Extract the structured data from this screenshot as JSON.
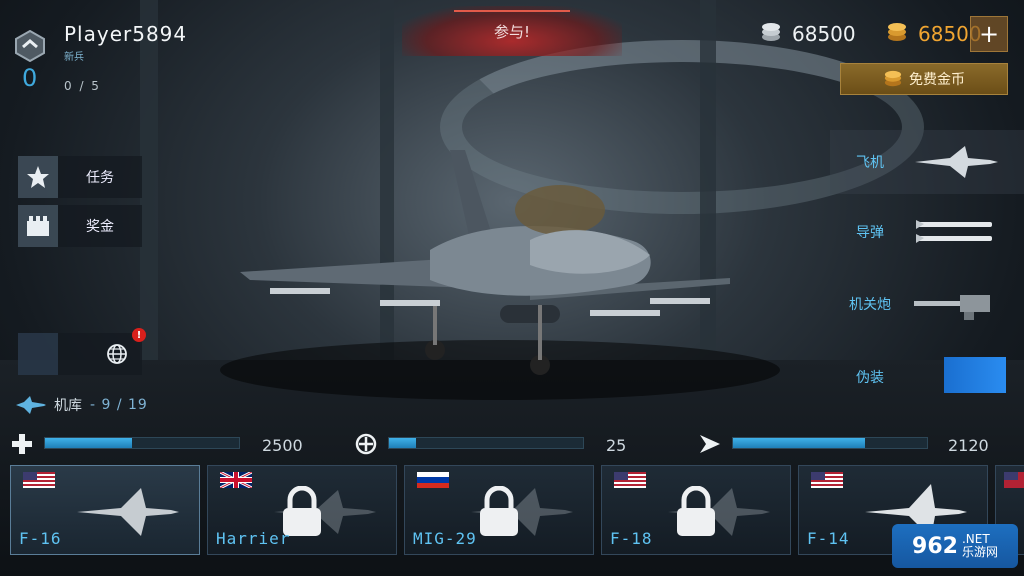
{
  "player": {
    "name": "Player5894",
    "rank_title": "新兵",
    "level": "0",
    "xp": "0 / 5"
  },
  "top": {
    "join_label": "参与!",
    "silver_amount": "68500",
    "gold_amount": "68500",
    "plus_label": "+",
    "free_gold_label": "免费金币"
  },
  "left_menu": {
    "missions_label": "任务",
    "rewards_label": "奖金",
    "notification_badge": "!",
    "hangar_label": "机库",
    "hangar_count": "- 9 / 19"
  },
  "categories": {
    "plane_label": "飞机",
    "missile_label": "导弹",
    "gun_label": "机关炮",
    "camo_label": "伪装",
    "camo_color": "#1e7ee0"
  },
  "stats": {
    "health_value": "2500",
    "health_fill": 0.45,
    "accuracy_value": "25",
    "accuracy_fill": 0.14,
    "speed_value": "2120",
    "speed_fill": 0.68
  },
  "aircraft": [
    {
      "name": "F-16",
      "flag": "usa",
      "locked": false
    },
    {
      "name": "Harrier",
      "flag": "uk",
      "locked": true
    },
    {
      "name": "MIG-29",
      "flag": "russia",
      "locked": true
    },
    {
      "name": "F-18",
      "flag": "usa",
      "locked": true
    },
    {
      "name": "F-14",
      "flag": "usa",
      "locked": false
    }
  ],
  "watermark": {
    "big": "962",
    "suffix": ".NET",
    "sub": "乐游网"
  },
  "colors": {
    "accent_blue": "#3fa9dd",
    "gold": "#f0a531",
    "alert_red": "#d9201c"
  }
}
